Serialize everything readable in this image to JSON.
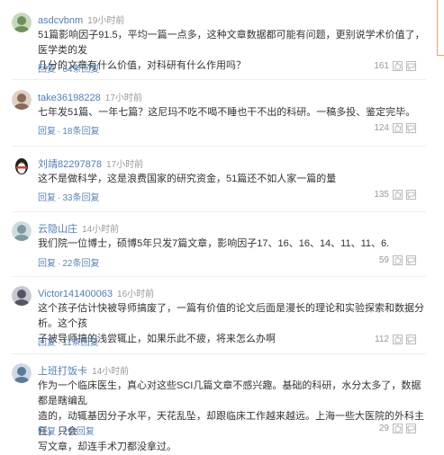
{
  "comments": [
    {
      "username": "asdcvbnm",
      "time": "19小时前",
      "lines": [
        "51篇影响因子91.5，平均一篇一点多，这种文章数据都可能有问题，更别说学术价值了，医学类的发",
        "几分的文章有什么价值，对科研有什么作用吗？"
      ],
      "reply": "回复",
      "replies": "64条回复",
      "likes": "161",
      "avatar_color": "#6f8f5a"
    },
    {
      "username": "take36198228",
      "time": "17小时前",
      "lines": [
        "七年发51篇、一年七篇？这尼玛不吃不喝不睡也干不出的科研。一稿多投、鉴定完毕。"
      ],
      "reply": "回复",
      "replies": "18条回复",
      "likes": "124",
      "avatar_color": "#8a6a5a"
    },
    {
      "username": "刘靖82297878",
      "time": "17小时前",
      "lines": [
        "这不是做科学，这是浪费国家的研究资金，51篇还不如人家一篇的量"
      ],
      "reply": "回复",
      "replies": "33条回复",
      "likes": "135",
      "avatar_color": "#d04030"
    },
    {
      "username": "云隐山庄",
      "time": "14小时前",
      "lines": [
        "我们院一位博士，硕博5年只发7篇文章，影响因子17、16、16、14、11、11、6."
      ],
      "reply": "回复",
      "replies": "22条回复",
      "likes": "59",
      "avatar_color": "#7a9aa0"
    },
    {
      "username": "Victor141400063",
      "time": "16小时前",
      "lines": [
        "这个孩子估计快被导师搞废了，一篇有价值的论文后面是漫长的理论和实验探索和数据分析。这个孩",
        "子被导师搞的浅尝辄止，如果乐此不疲，将来怎么办啊"
      ],
      "reply": "回复",
      "replies": "11条回复",
      "likes": "112",
      "avatar_color": "#555566"
    },
    {
      "username": "上班打饭卡",
      "time": "14小时前",
      "lines": [
        "作为一个临床医生，真心对这些SCI几篇文章不感兴趣。基础的科研，水分太多了，数据都是瞎编乱",
        "造的，动辄基因分子水平，天花乱坠，却跟临床工作越来越远。上海一些大医院的外科主任，只会",
        "写文章，却连手术刀都没拿过。"
      ],
      "reply": "回复",
      "replies": "2条回复",
      "likes": "29",
      "avatar_color": "#5a7a9a"
    }
  ]
}
